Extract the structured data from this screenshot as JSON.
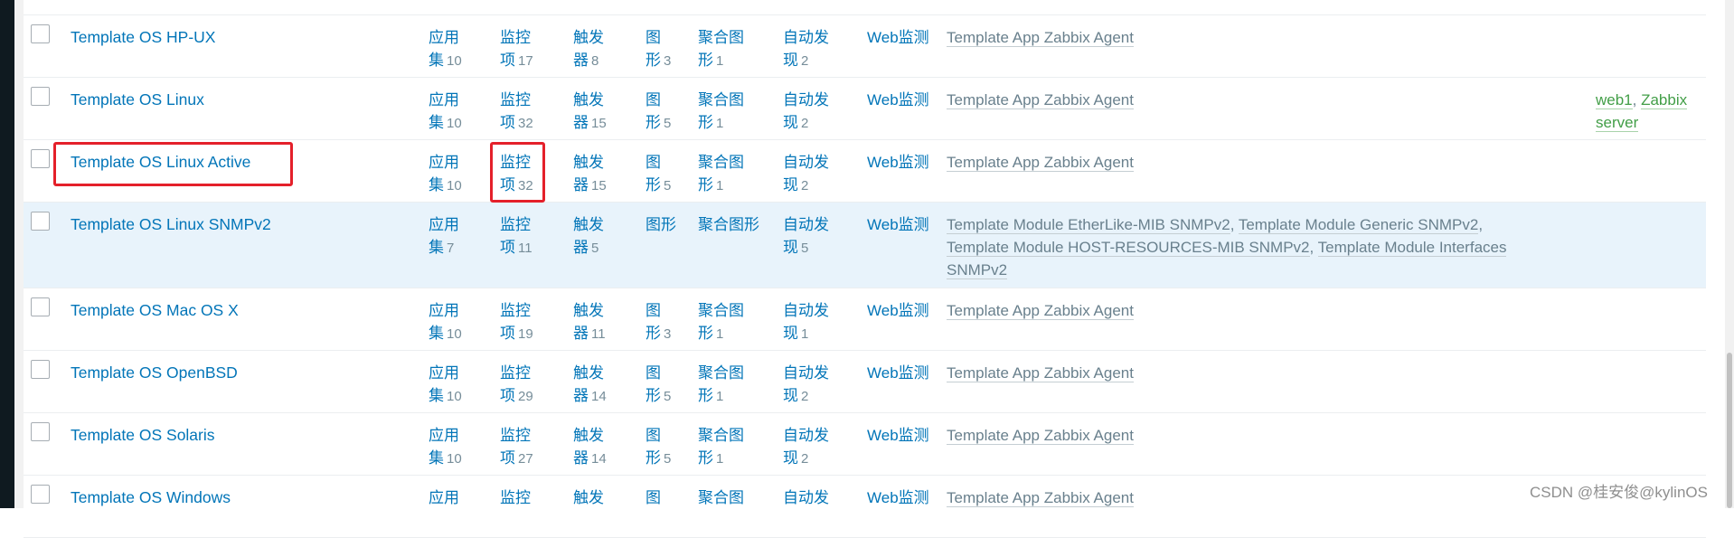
{
  "colors": {
    "link": "#0275b8",
    "count": "#768d99",
    "template_link": "#69808d",
    "host_link": "#429e47",
    "highlight_row": "#e8f3fb",
    "annotation": "#e4202a"
  },
  "labels": {
    "apps": "应用集",
    "items": "监控项",
    "triggers": "触发器",
    "graphs": "图形",
    "screens": "聚合图形",
    "discovery": "自动发现",
    "web": "Web监测"
  },
  "rows": [
    {
      "name": "Template OS HP-UX",
      "apps": "10",
      "items": "17",
      "triggers": "8",
      "graphs": "3",
      "screens": "1",
      "discovery": "2",
      "linked": [
        "Template App Zabbix Agent"
      ],
      "linked_to": []
    },
    {
      "name": "Template OS Linux",
      "apps": "10",
      "items": "32",
      "triggers": "15",
      "graphs": "5",
      "screens": "1",
      "discovery": "2",
      "linked": [
        "Template App Zabbix Agent"
      ],
      "linked_to": [
        "web1",
        "Zabbix server"
      ]
    },
    {
      "name": "Template OS Linux Active",
      "apps": "10",
      "items": "32",
      "triggers": "15",
      "graphs": "5",
      "screens": "1",
      "discovery": "2",
      "linked": [
        "Template App Zabbix Agent"
      ],
      "linked_to": []
    },
    {
      "name": "Template OS Linux SNMPv2",
      "apps": "7",
      "items": "11",
      "triggers": "5",
      "graphs": "",
      "screens": "",
      "discovery": "5",
      "linked": [
        "Template Module EtherLike-MIB SNMPv2",
        "Template Module Generic SNMPv2",
        "Template Module HOST-RESOURCES-MIB SNMPv2",
        "Template Module Interfaces SNMPv2"
      ],
      "linked_to": []
    },
    {
      "name": "Template OS Mac OS X",
      "apps": "10",
      "items": "19",
      "triggers": "11",
      "graphs": "3",
      "screens": "1",
      "discovery": "1",
      "linked": [
        "Template App Zabbix Agent"
      ],
      "linked_to": []
    },
    {
      "name": "Template OS OpenBSD",
      "apps": "10",
      "items": "29",
      "triggers": "14",
      "graphs": "5",
      "screens": "1",
      "discovery": "2",
      "linked": [
        "Template App Zabbix Agent"
      ],
      "linked_to": []
    },
    {
      "name": "Template OS Solaris",
      "apps": "10",
      "items": "27",
      "triggers": "14",
      "graphs": "5",
      "screens": "1",
      "discovery": "2",
      "linked": [
        "Template App Zabbix Agent"
      ],
      "linked_to": []
    },
    {
      "name": "Template OS Windows",
      "apps": "",
      "items": "",
      "triggers": "",
      "graphs": "",
      "screens": "",
      "discovery": "",
      "linked": [
        "Template App Zabbix Agent"
      ],
      "linked_to": []
    }
  ],
  "watermark": "CSDN @桂安俊@kylinOS"
}
